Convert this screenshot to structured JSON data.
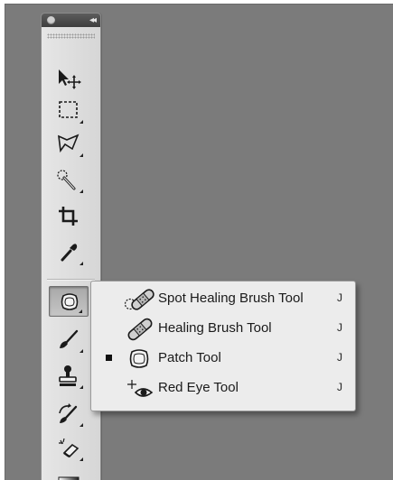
{
  "panel": {
    "collapse_glyph": "◂◂"
  },
  "tools": [
    {
      "name": "move-tool",
      "icon": "move-icon"
    },
    {
      "name": "marquee-tool",
      "icon": "rect-marquee-icon"
    },
    {
      "name": "lasso-tool",
      "icon": "polygonal-lasso-icon"
    },
    {
      "name": "quick-selection-tool",
      "icon": "quick-selection-icon"
    },
    {
      "name": "crop-tool",
      "icon": "crop-icon"
    },
    {
      "name": "eyedropper-tool",
      "icon": "eyedropper-icon"
    },
    {
      "name": "healing-tool",
      "icon": "patch-icon",
      "selected": true
    },
    {
      "name": "brush-tool",
      "icon": "brush-icon"
    },
    {
      "name": "clone-stamp-tool",
      "icon": "stamp-icon"
    },
    {
      "name": "history-brush-tool",
      "icon": "history-brush-icon"
    },
    {
      "name": "eraser-tool",
      "icon": "eraser-icon"
    },
    {
      "name": "gradient-tool",
      "icon": "gradient-icon"
    }
  ],
  "flyout": {
    "items": [
      {
        "label": "Spot Healing Brush Tool",
        "shortcut": "J",
        "icon": "spot-healing-brush-icon",
        "active": false
      },
      {
        "label": "Healing Brush Tool",
        "shortcut": "J",
        "icon": "healing-brush-icon",
        "active": false
      },
      {
        "label": "Patch Tool",
        "shortcut": "J",
        "icon": "patch-icon",
        "active": true
      },
      {
        "label": "Red Eye Tool",
        "shortcut": "J",
        "icon": "red-eye-icon",
        "active": false
      }
    ]
  },
  "colors": {
    "canvas": "#7b7b7b",
    "panel": "#dedede",
    "titlebar": "#4a4a4a",
    "menu": "#ececec"
  }
}
